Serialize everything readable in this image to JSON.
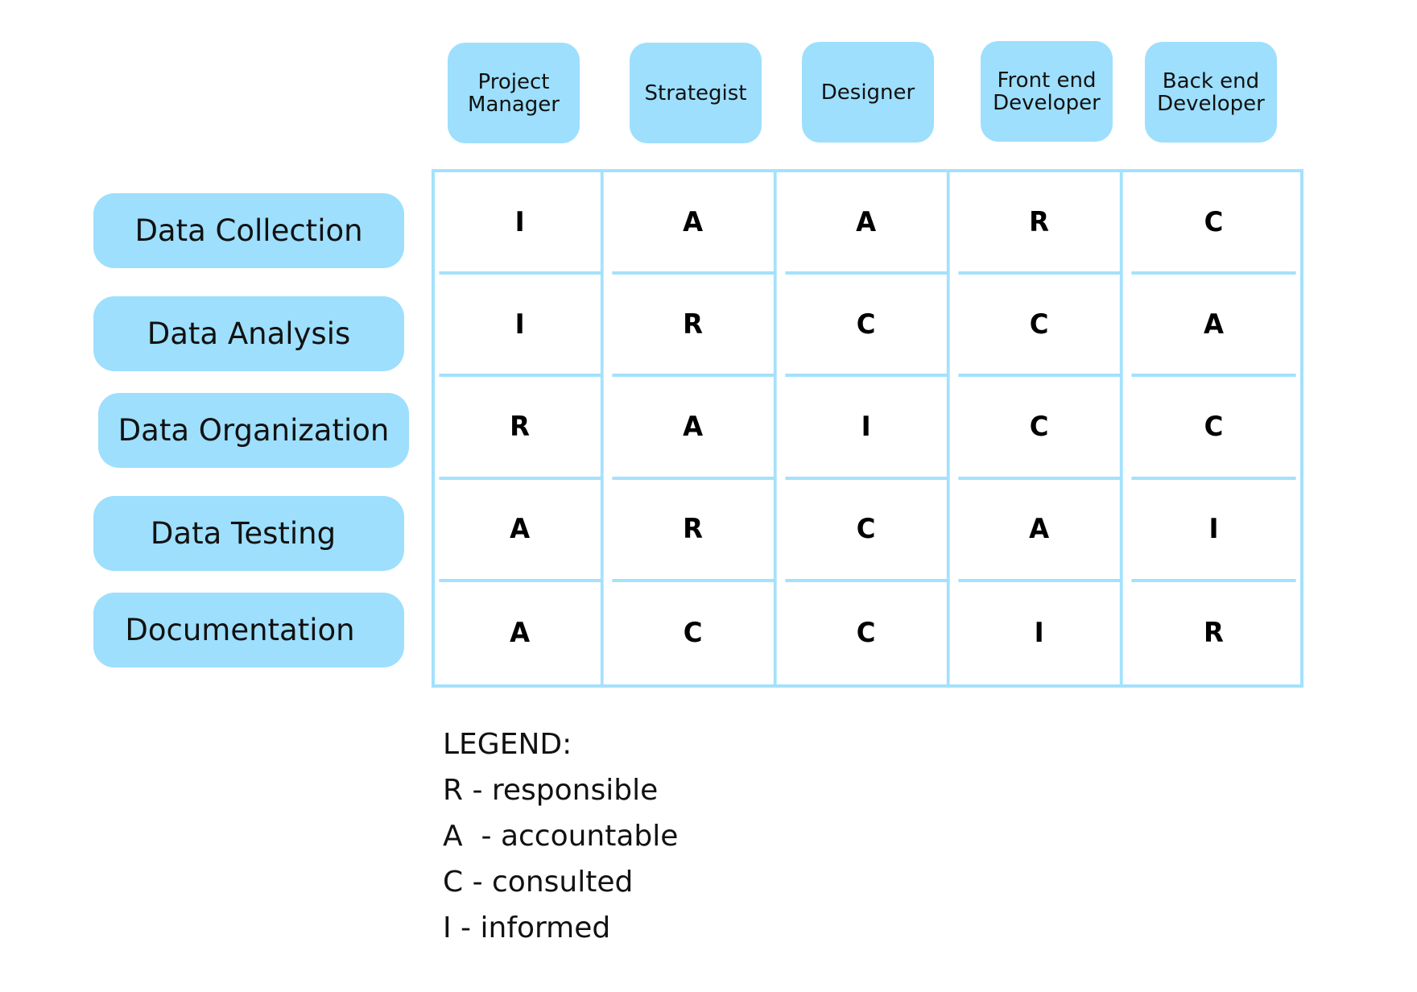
{
  "roles": [
    {
      "label_line1": "Project",
      "label_line2": "Manager"
    },
    {
      "label_line1": "Strategist",
      "label_line2": ""
    },
    {
      "label_line1": "Designer",
      "label_line2": ""
    },
    {
      "label_line1": "Front end",
      "label_line2": "Developer"
    },
    {
      "label_line1": "Back end",
      "label_line2": "Developer"
    }
  ],
  "tasks": [
    {
      "label": "Data Collection",
      "assignments": [
        "I",
        "A",
        "A",
        "R",
        "C"
      ]
    },
    {
      "label": "Data Analysis",
      "assignments": [
        "I",
        "R",
        "C",
        "C",
        "A"
      ]
    },
    {
      "label": "Data Organization",
      "assignments": [
        "R",
        "A",
        "I",
        "C",
        "C"
      ]
    },
    {
      "label": "Data Testing",
      "assignments": [
        "A",
        "R",
        "C",
        "A",
        "I"
      ]
    },
    {
      "label": "Documentation",
      "assignments": [
        "A",
        "C",
        "C",
        "I",
        "R"
      ]
    }
  ],
  "legend": {
    "title": "LEGEND:",
    "items": [
      "R - responsible",
      "A  - accountable",
      "C - consulted",
      "I - informed"
    ]
  },
  "colors": {
    "box_fill": "#9ddffd",
    "grid_line": "#a4e1fd",
    "text": "#111111"
  }
}
